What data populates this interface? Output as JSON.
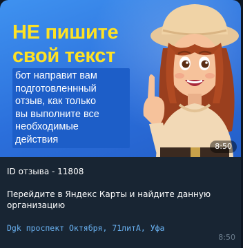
{
  "image": {
    "title": "НЕ пишите\nсвой текст",
    "body": "бот направит вам\nподготовленнный\nотзыв, как только\nвы выполните все\nнеобходимые\nдействия",
    "time": "8:50"
  },
  "message": {
    "review_id": "ID отзыва - 11808",
    "instruction": "Перейдите в Яндекс Карты и найдите данную организацию",
    "address": "Dgk проспект Октября, 71литА, Уфа",
    "time": "8:50"
  },
  "colors": {
    "banner_blue": "#2b6fdb",
    "title_yellow": "#ffe223",
    "bubble_bg": "#182533",
    "address_blue": "#6ab3f3"
  }
}
